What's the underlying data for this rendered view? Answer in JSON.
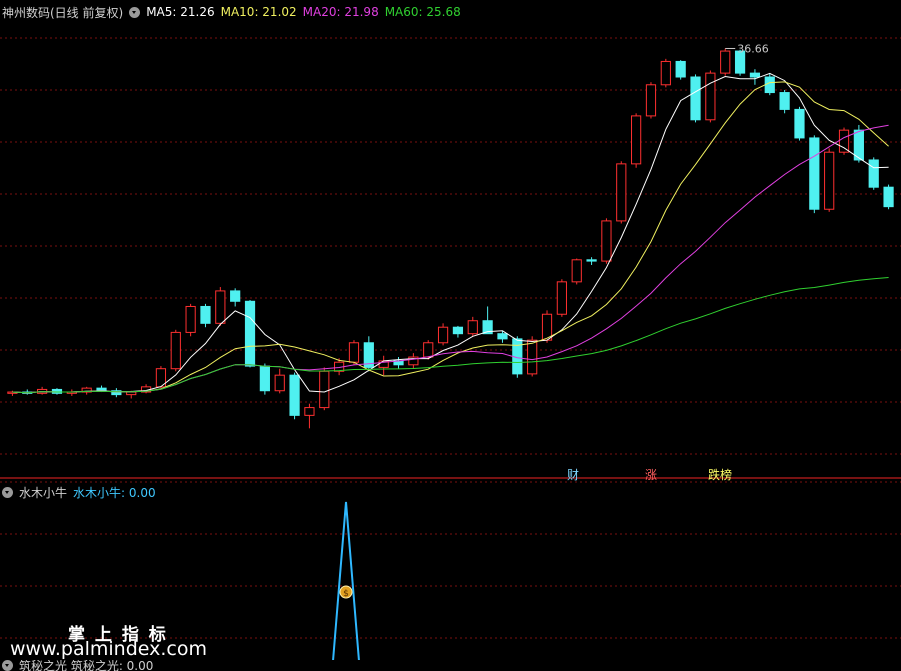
{
  "main": {
    "title": "神州数码(日线 前复权)",
    "indicators": [
      {
        "label": "MA5: 21.26",
        "color": "#ffffff"
      },
      {
        "label": "MA10: 21.02",
        "color": "#f0f060"
      },
      {
        "label": "MA20: 21.98",
        "color": "#e040e0"
      },
      {
        "label": "MA60: 25.68",
        "color": "#30d030"
      }
    ],
    "peak_label": "36.66",
    "markers": [
      {
        "text": "财",
        "color": "#7fd7ff"
      },
      {
        "text": "涨",
        "color": "#ff6060"
      },
      {
        "text": "跌榜",
        "color": "#ffff66"
      }
    ]
  },
  "sub": {
    "title": "水木小牛",
    "value_label": "水木小牛: 0.00",
    "value_color": "#3fc8ff"
  },
  "bottom": {
    "label": "筑秘之光 筑秘之光: 0.00"
  },
  "watermark": {
    "line1": "掌 上 指 标",
    "line2": "www.palmindex.com"
  },
  "colors": {
    "up": "#ff3030",
    "down": "#4ff0f0",
    "grid": "#7a1010",
    "axis": "#a01818"
  },
  "chart_data": {
    "type": "candlestick",
    "peak_high": 36.66,
    "candles": [
      [
        10.1,
        10.3,
        9.9,
        10.2
      ],
      [
        10.2,
        10.4,
        10.0,
        10.1
      ],
      [
        10.1,
        10.6,
        10.0,
        10.4
      ],
      [
        10.4,
        10.5,
        10.0,
        10.1
      ],
      [
        10.1,
        10.4,
        9.9,
        10.2
      ],
      [
        10.2,
        10.6,
        10.0,
        10.5
      ],
      [
        10.5,
        10.7,
        10.2,
        10.3
      ],
      [
        10.3,
        10.5,
        9.8,
        10.0
      ],
      [
        10.0,
        10.3,
        9.7,
        10.2
      ],
      [
        10.2,
        10.8,
        10.1,
        10.6
      ],
      [
        10.6,
        12.2,
        10.5,
        12.0
      ],
      [
        12.0,
        15.0,
        11.8,
        14.8
      ],
      [
        14.8,
        17.0,
        14.5,
        16.8
      ],
      [
        16.8,
        17.0,
        15.2,
        15.5
      ],
      [
        15.5,
        18.3,
        15.3,
        18.0
      ],
      [
        18.0,
        18.2,
        16.8,
        17.2
      ],
      [
        17.2,
        17.3,
        12.1,
        12.2
      ],
      [
        12.2,
        12.4,
        10.0,
        10.3
      ],
      [
        10.3,
        12.0,
        10.1,
        11.5
      ],
      [
        11.5,
        11.7,
        8.1,
        8.4
      ],
      [
        8.4,
        9.3,
        7.4,
        9.0
      ],
      [
        9.0,
        12.1,
        8.8,
        11.8
      ],
      [
        11.8,
        12.8,
        11.5,
        12.5
      ],
      [
        12.5,
        14.2,
        12.3,
        14.0
      ],
      [
        14.0,
        14.5,
        11.8,
        12.1
      ],
      [
        12.1,
        13.0,
        11.5,
        12.6
      ],
      [
        12.6,
        12.9,
        12.0,
        12.3
      ],
      [
        12.3,
        13.2,
        12.0,
        12.9
      ],
      [
        12.9,
        14.2,
        12.7,
        14.0
      ],
      [
        14.0,
        15.5,
        13.8,
        15.2
      ],
      [
        15.2,
        15.3,
        14.4,
        14.7
      ],
      [
        14.7,
        16.0,
        14.5,
        15.7
      ],
      [
        15.7,
        16.8,
        15.5,
        14.7
      ],
      [
        14.7,
        14.9,
        14.0,
        14.3
      ],
      [
        14.3,
        14.5,
        11.3,
        11.6
      ],
      [
        11.6,
        14.5,
        11.4,
        14.2
      ],
      [
        14.2,
        16.5,
        14.0,
        16.2
      ],
      [
        16.2,
        18.9,
        16.0,
        18.7
      ],
      [
        18.7,
        20.5,
        18.5,
        20.4
      ],
      [
        20.4,
        20.6,
        20.0,
        20.3
      ],
      [
        20.3,
        23.6,
        20.1,
        23.4
      ],
      [
        23.4,
        28.0,
        23.2,
        27.8
      ],
      [
        27.8,
        31.7,
        27.5,
        31.5
      ],
      [
        31.5,
        34.1,
        31.3,
        33.9
      ],
      [
        33.9,
        35.9,
        33.7,
        35.7
      ],
      [
        35.7,
        35.8,
        34.3,
        34.5
      ],
      [
        34.5,
        34.7,
        31.0,
        31.2
      ],
      [
        31.2,
        35.0,
        31.0,
        34.8
      ],
      [
        34.8,
        36.7,
        34.6,
        36.5
      ],
      [
        36.5,
        36.6,
        34.6,
        34.8
      ],
      [
        34.8,
        35.1,
        33.9,
        34.5
      ],
      [
        34.5,
        34.8,
        33.1,
        33.3
      ],
      [
        33.3,
        33.5,
        31.7,
        32.0
      ],
      [
        32.0,
        32.2,
        29.6,
        29.8
      ],
      [
        29.8,
        30.0,
        24.0,
        24.3
      ],
      [
        24.3,
        29.0,
        24.1,
        28.7
      ],
      [
        28.7,
        30.6,
        28.5,
        30.4
      ],
      [
        30.4,
        30.8,
        27.9,
        28.1
      ],
      [
        28.1,
        28.3,
        25.8,
        26.0
      ],
      [
        26.0,
        26.2,
        24.3,
        24.5
      ]
    ],
    "signal": {
      "peak_value": 1.0,
      "baseline": 0.0
    }
  }
}
